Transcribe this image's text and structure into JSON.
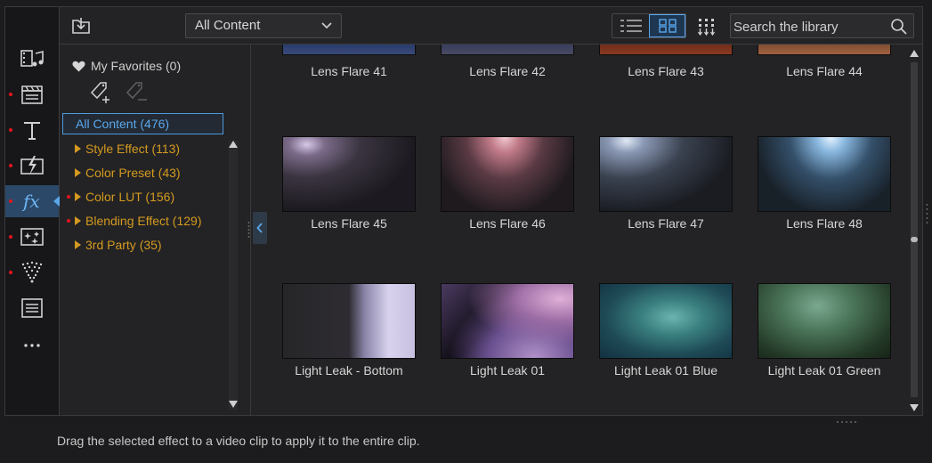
{
  "toolbar": {
    "filter_value": "All Content",
    "search_placeholder": "Search the library",
    "view_modes": [
      "list-view-icon",
      "grid-view-icon"
    ],
    "selected_view": "grid"
  },
  "rail": {
    "items": [
      {
        "icon": "media-room-icon",
        "dot": false,
        "active": false
      },
      {
        "icon": "titles-clapper-icon",
        "dot": true,
        "active": false
      },
      {
        "icon": "text-icon",
        "dot": true,
        "active": false
      },
      {
        "icon": "transition-icon",
        "dot": true,
        "active": false
      },
      {
        "icon": "effects-fx-icon",
        "dot": true,
        "active": true
      },
      {
        "icon": "particle-icon",
        "dot": true,
        "active": false
      },
      {
        "icon": "overlay-icon",
        "dot": true,
        "active": false
      },
      {
        "icon": "subtitle-icon",
        "dot": false,
        "active": false
      },
      {
        "icon": "more-icon",
        "dot": false,
        "active": false
      }
    ]
  },
  "categories": {
    "favorites": "My Favorites (0)",
    "all_content": "All Content (476)",
    "items": [
      {
        "label": "Style Effect  (113)",
        "dot": false
      },
      {
        "label": "Color Preset  (43)",
        "dot": false
      },
      {
        "label": "Color LUT  (156)",
        "dot": true
      },
      {
        "label": "Blending Effect  (129)",
        "dot": true
      },
      {
        "label": "3rd Party  (35)",
        "dot": false
      }
    ]
  },
  "grid": {
    "rows": [
      [
        {
          "label": "Lens Flare 41"
        },
        {
          "label": "Lens Flare 42"
        },
        {
          "label": "Lens Flare 43"
        },
        {
          "label": "Lens Flare 44"
        }
      ],
      [
        {
          "label": "Lens Flare 45"
        },
        {
          "label": "Lens Flare 46"
        },
        {
          "label": "Lens Flare 47"
        },
        {
          "label": "Lens Flare 48"
        }
      ],
      [
        {
          "label": "Light Leak - Bottom"
        },
        {
          "label": "Light Leak 01"
        },
        {
          "label": "Light Leak 01 Blue"
        },
        {
          "label": "Light Leak 01 Green"
        }
      ]
    ]
  },
  "status": "Drag the selected effect to a video clip to apply it to the entire clip.",
  "colors": {
    "accent": "#5aa7ec",
    "category_text": "#d49a1f",
    "notification_dot": "#e8141b"
  }
}
